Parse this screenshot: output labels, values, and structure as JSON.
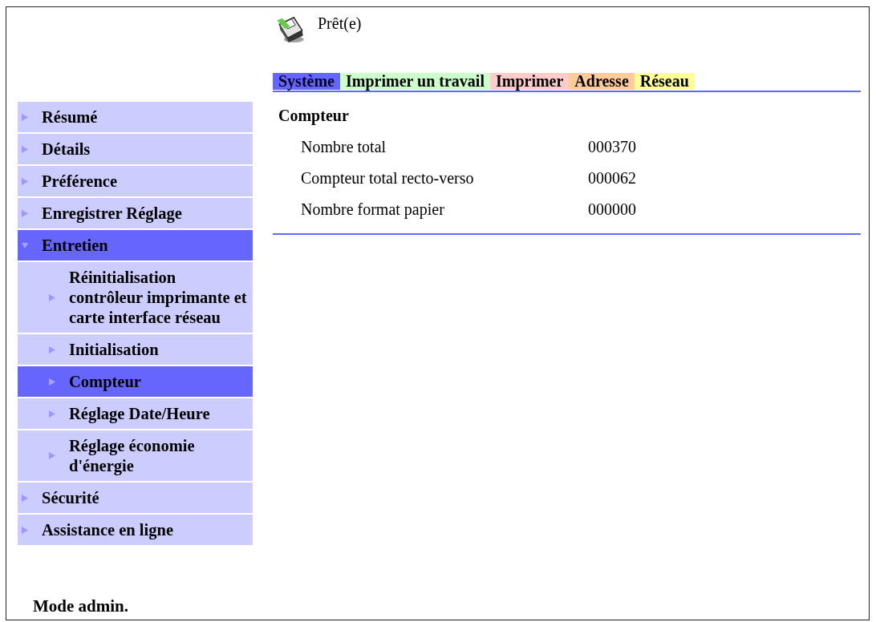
{
  "status": {
    "text": "Prêt(e)"
  },
  "tabs": [
    {
      "label": "Système",
      "color": "#6666ff",
      "selected": true
    },
    {
      "label": "Imprimer un travail",
      "color": "#ccffcc",
      "selected": false
    },
    {
      "label": "Imprimer",
      "color": "#ffcccc",
      "selected": false
    },
    {
      "label": "Adresse",
      "color": "#ffcc99",
      "selected": false
    },
    {
      "label": "Réseau",
      "color": "#ffff99",
      "selected": false
    }
  ],
  "sidebar": {
    "items": [
      {
        "label": "Résumé",
        "selected": false,
        "expanded": false
      },
      {
        "label": "Détails",
        "selected": false,
        "expanded": false
      },
      {
        "label": "Préférence",
        "selected": false,
        "expanded": false
      },
      {
        "label": "Enregistrer Réglage",
        "selected": false,
        "expanded": false
      },
      {
        "label": "Entretien",
        "selected": true,
        "expanded": true,
        "children": [
          {
            "label": "Réinitialisation contrôleur imprimante et carte interface réseau",
            "selected": false
          },
          {
            "label": "Initialisation",
            "selected": false
          },
          {
            "label": "Compteur",
            "selected": true
          },
          {
            "label": "Réglage Date/Heure",
            "selected": false
          },
          {
            "label": "Réglage économie d'énergie",
            "selected": false
          }
        ]
      },
      {
        "label": "Sécurité",
        "selected": false,
        "expanded": false
      },
      {
        "label": "Assistance en ligne",
        "selected": false,
        "expanded": false
      }
    ]
  },
  "content": {
    "title": "Compteur",
    "rows": [
      {
        "label": "Nombre total",
        "value": "000370"
      },
      {
        "label": "Compteur total recto-verso",
        "value": "000062"
      },
      {
        "label": "Nombre format papier",
        "value": "000000"
      }
    ]
  },
  "footer": {
    "mode": "Mode admin."
  }
}
